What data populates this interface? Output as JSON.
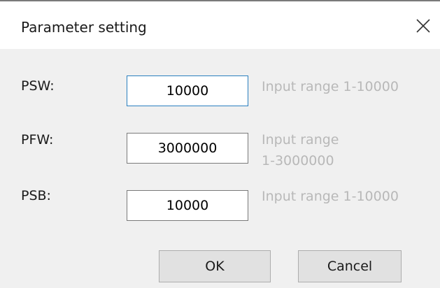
{
  "dialog": {
    "title": "Parameter setting",
    "close_glyph": "close-icon"
  },
  "fields": [
    {
      "label": "PSW:",
      "value": "10000",
      "hint": "Input range 1-10000"
    },
    {
      "label": "PFW:",
      "value": "3000000",
      "hint_line1": "Input range",
      "hint_line2": "1-3000000"
    },
    {
      "label": "PSB:",
      "value": "10000",
      "hint": "Input range 1-10000"
    }
  ],
  "buttons": {
    "ok": "OK",
    "cancel": "Cancel"
  },
  "colors": {
    "focus_border": "#2a7fbf",
    "hint_text": "#b8b8b8",
    "dialog_bg": "#f0f0f0"
  }
}
